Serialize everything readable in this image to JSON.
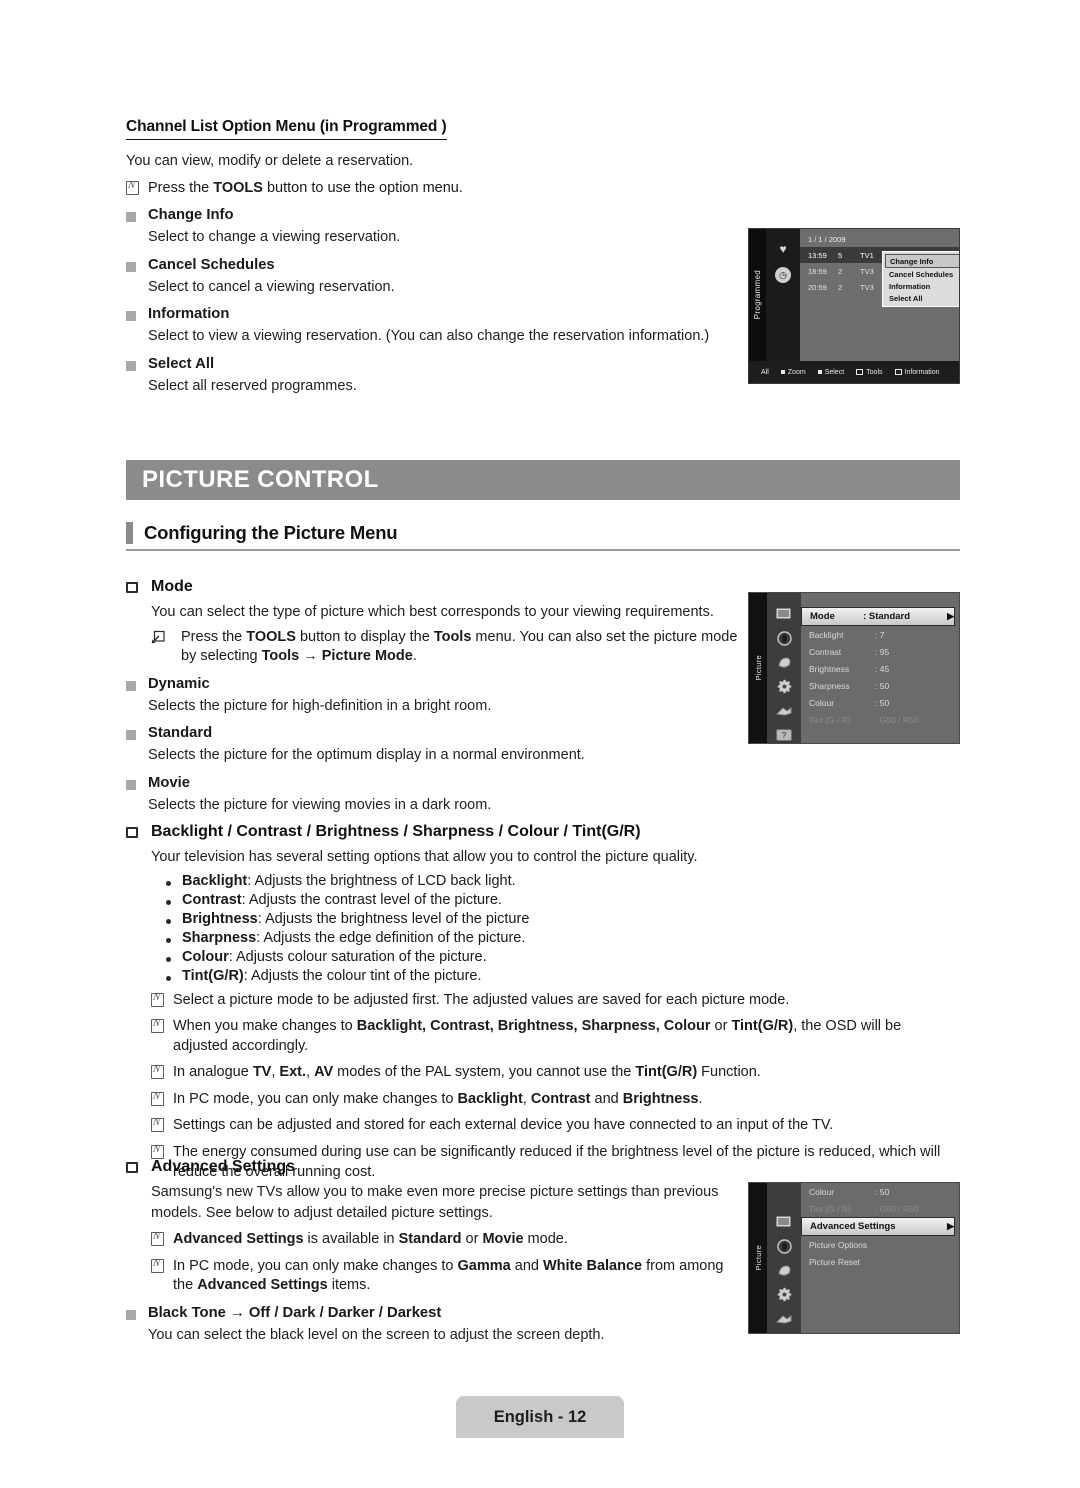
{
  "section1": {
    "title": "Channel List Option Menu (in Programmed )",
    "lead": "You can view, modify or delete a reservation.",
    "note": "Press the TOOLS button to use the option menu.",
    "items": [
      {
        "label": "Change Info",
        "desc": "Select to change a viewing reservation."
      },
      {
        "label": "Cancel Schedules",
        "desc": "Select to cancel a viewing reservation."
      },
      {
        "label": "Information",
        "desc": "Select to view a viewing reservation. (You can also change the reservation information.)"
      },
      {
        "label": "Select All",
        "desc": "Select all reserved programmes."
      }
    ]
  },
  "banner": {
    "title": "PICTURE CONTROL"
  },
  "heading_configuring": "Configuring the Picture Menu",
  "mode": {
    "heading": "Mode",
    "desc": "You can select the type of picture which best corresponds to your viewing requirements.",
    "tools_note": "Press the TOOLS button to display the Tools menu. You can also set the picture mode by selecting Tools → Picture Mode.",
    "items": [
      {
        "label": "Dynamic",
        "desc": "Selects the picture for high-definition in a bright room."
      },
      {
        "label": "Standard",
        "desc": "Selects the picture for the optimum display in a normal environment."
      },
      {
        "label": "Movie",
        "desc": "Selects the picture for viewing movies in a dark room."
      }
    ]
  },
  "backlight": {
    "heading": "Backlight / Contrast / Brightness / Sharpness / Colour / Tint(G/R)",
    "desc": "Your television has several setting options that allow you to control the picture quality.",
    "bullets": [
      {
        "term": "Backlight",
        "text": ": Adjusts the brightness of LCD back light."
      },
      {
        "term": "Contrast",
        "text": ": Adjusts the contrast level of the picture."
      },
      {
        "term": "Brightness",
        "text": ": Adjusts the brightness level of the picture"
      },
      {
        "term": "Sharpness",
        "text": ": Adjusts the edge definition of the picture."
      },
      {
        "term": "Colour",
        "text": ": Adjusts colour saturation of the picture."
      },
      {
        "term": "Tint(G/R)",
        "text": ": Adjusts the colour tint of the picture."
      }
    ],
    "notes": [
      "Select a picture mode to be adjusted first. The adjusted values are saved for each picture mode.",
      "When you make changes to Backlight, Contrast, Brightness, Sharpness, Colour or Tint(G/R), the OSD will be adjusted accordingly.",
      "In analogue TV, Ext., AV modes of the PAL system, you cannot use the Tint(G/R) Function.",
      "In PC mode, you can only make changes to Backlight, Contrast and Brightness.",
      "Settings can be adjusted and stored for each external device you have connected to an input of the TV.",
      "The energy consumed during use can be significantly reduced if the brightness level of the picture is reduced, which will reduce the overall running cost."
    ]
  },
  "advanced": {
    "heading": "Advanced Settings",
    "desc": "Samsung's new TVs allow you to make even more precise picture settings than previous models. See below to adjust detailed picture settings.",
    "notes": [
      "Advanced Settings is available in Standard or Movie mode.",
      "In PC mode, you can only make changes to Gamma and White Balance from among the Advanced Settings items."
    ],
    "black_tone": {
      "label": "Black Tone → Off / Dark / Darker / Darkest",
      "desc": "You can select the black level on the screen to adjust the screen depth."
    }
  },
  "osd_programmed": {
    "rail_label": "Programmed",
    "date": "1 / 1 / 2009",
    "rows": [
      {
        "time": "13:59",
        "num": "5",
        "channel": "TV1"
      },
      {
        "time": "18:59",
        "num": "2",
        "channel": "TV3"
      },
      {
        "time": "20:59",
        "num": "2",
        "channel": "TV3"
      }
    ],
    "popup": [
      "Change Info",
      "Cancel Schedules",
      "Information",
      "Select All"
    ],
    "bottom_bar": [
      "All",
      "Zoom",
      "Select",
      "Tools",
      "Information"
    ]
  },
  "osd_picture": {
    "rail_label": "Picture",
    "items": [
      {
        "label": "Mode",
        "value": ": Standard",
        "state": "selected"
      },
      {
        "label": "Backlight",
        "value": ": 7",
        "state": "normal"
      },
      {
        "label": "Contrast",
        "value": ": 95",
        "state": "normal"
      },
      {
        "label": "Brightness",
        "value": ": 45",
        "state": "normal"
      },
      {
        "label": "Sharpness",
        "value": ": 50",
        "state": "normal"
      },
      {
        "label": "Colour",
        "value": ": 50",
        "state": "normal"
      },
      {
        "label": "Tint (G / R)",
        "value": ": G50 / R50",
        "state": "dim"
      }
    ]
  },
  "osd_advanced": {
    "rail_label": "Picture",
    "items": [
      {
        "label": "Colour",
        "value": ": 50",
        "state": "normal"
      },
      {
        "label": "Tint (G / R)",
        "value": ": G50 / R50",
        "state": "dim"
      },
      {
        "label": "Advanced Settings",
        "value": "",
        "state": "selected"
      },
      {
        "label": "Picture Options",
        "value": "",
        "state": "normal"
      },
      {
        "label": "Picture Reset",
        "value": "",
        "state": "normal"
      }
    ]
  },
  "footer": {
    "page": "English - 12"
  },
  "colors": {
    "banner_gray": "#8b8b8b",
    "bullet_gray": "#a8a8a8",
    "footer_gray": "#c9c9c9",
    "text": "#1a1a1a"
  }
}
